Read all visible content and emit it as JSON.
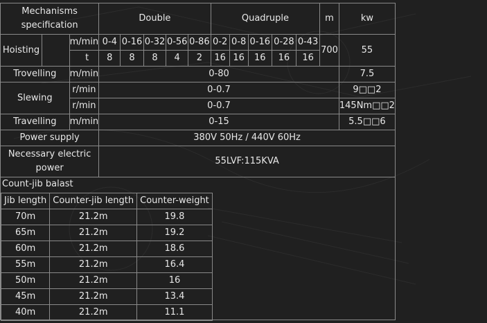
{
  "header": {
    "mechanisms": "Mechanisms specification",
    "double": "Double",
    "quadruple": "Quadruple",
    "m": "m",
    "kw": "kw"
  },
  "hoisting": {
    "label": "Hoisting",
    "unit_speed": "m/min",
    "unit_load": "t",
    "speeds": [
      "0-4",
      "0-16",
      "0-32",
      "0-56",
      "0-86",
      "0-2",
      "0-8",
      "0-16",
      "0-28",
      "0-43"
    ],
    "loads": [
      "8",
      "8",
      "8",
      "4",
      "2",
      "16",
      "16",
      "16",
      "16",
      "16"
    ],
    "m": "700",
    "kw": "55"
  },
  "trovelling": {
    "label": "Trovelling",
    "unit": "m/min",
    "value": "0-80",
    "kw": "7.5"
  },
  "slewing": {
    "label": "Slewing",
    "unit1": "r/min",
    "value1": "0-0.7",
    "kw1": "9□□2",
    "unit2": "r/min",
    "value2": "0-0.7",
    "kw2": "145Nm□□2"
  },
  "travelling": {
    "label": "Travelling",
    "unit": "m/min",
    "value": "0-15",
    "kw": "5.5□□6"
  },
  "power_supply": {
    "label": "Power  supply",
    "value": "380V  50Hz  /  440V  60Hz"
  },
  "electric_power": {
    "label": "Necessary  electric power",
    "value": "55LVF:115KVA"
  },
  "balast": {
    "title": "Count-jib  balast",
    "headers": [
      "Jib  length",
      "Counter-jib  length",
      "Counter-weight"
    ],
    "rows": [
      [
        "70m",
        "21.2m",
        "19.8"
      ],
      [
        "65m",
        "21.2m",
        "19.2"
      ],
      [
        "60m",
        "21.2m",
        "18.6"
      ],
      [
        "55m",
        "21.2m",
        "16.4"
      ],
      [
        "50m",
        "21.2m",
        "16"
      ],
      [
        "45m",
        "21.2m",
        "13.4"
      ],
      [
        "40m",
        "21.2m",
        "11.1"
      ]
    ]
  }
}
